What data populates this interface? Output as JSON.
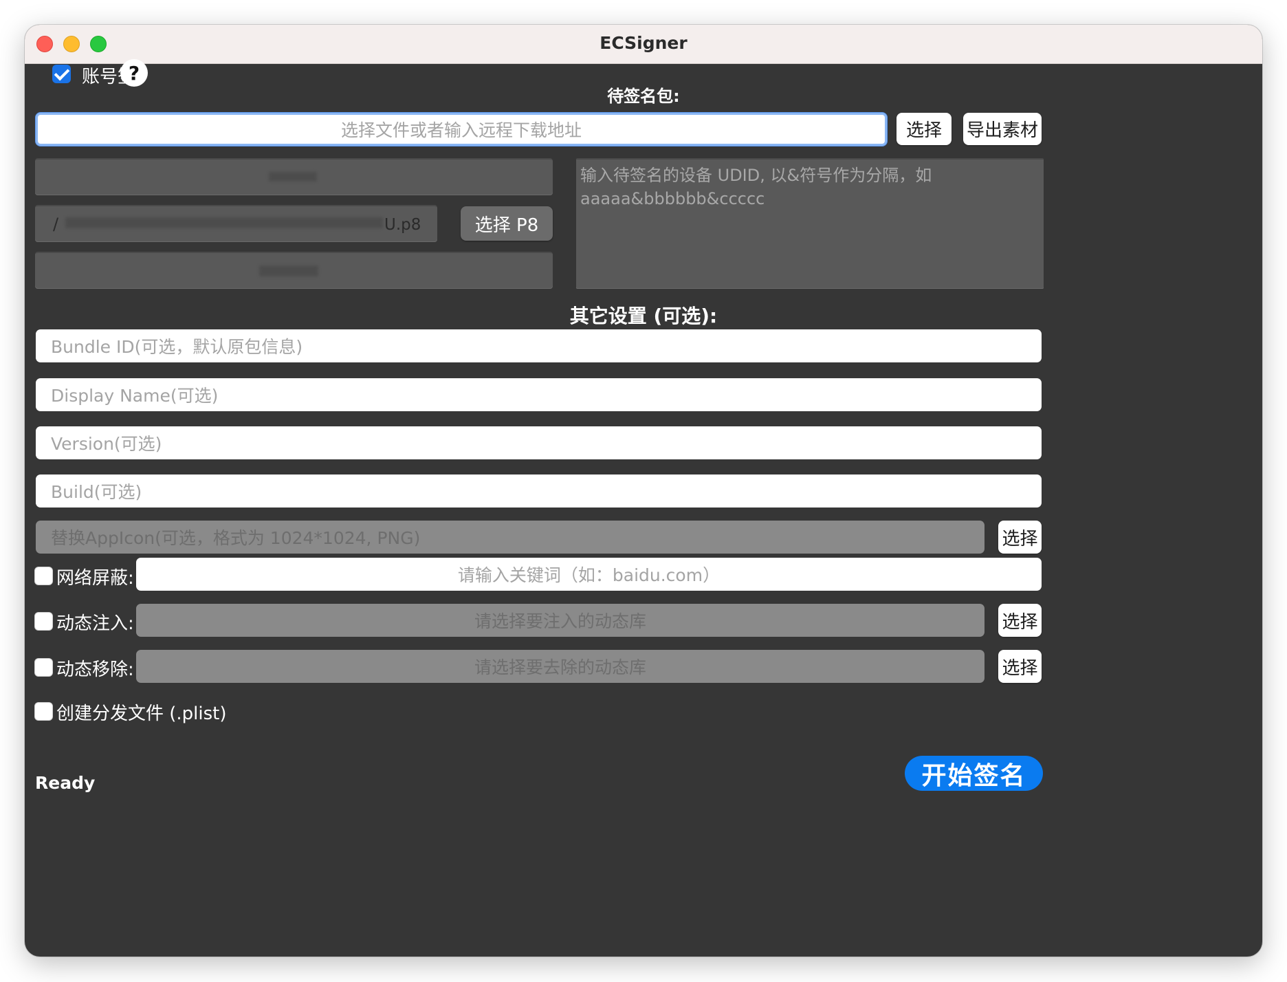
{
  "window": {
    "title": "ECSigner"
  },
  "account": {
    "checkbox_label": "账号签",
    "checked": true,
    "help_glyph": "?"
  },
  "package": {
    "heading": "待签名包:",
    "input_placeholder": "选择文件或者输入远程下载地址",
    "select_button": "选择",
    "export_button": "导出素材"
  },
  "credentials": {
    "p8_path_suffix": "U.p8",
    "p8_path_prefix": "/",
    "select_p8_button": "选择 P8"
  },
  "udid": {
    "placeholder": "输入待签名的设备 UDID, 以&符号作为分隔，如 aaaaa&bbbbbb&ccccc"
  },
  "other_settings": {
    "heading": "其它设置 (可选):",
    "bundle_id_placeholder": "Bundle ID(可选，默认原包信息)",
    "display_name_placeholder": "Display Name(可选)",
    "version_placeholder": "Version(可选)",
    "build_placeholder": "Build(可选)",
    "appicon_placeholder": "替换AppIcon(可选，格式为 1024*1024, PNG)",
    "appicon_select_button": "选择"
  },
  "network_block": {
    "label": "网络屏蔽:",
    "checked": false,
    "placeholder": "请输入关键词（如：baidu.com）"
  },
  "dylib_inject": {
    "label": "动态注入:",
    "checked": false,
    "placeholder": "请选择要注入的动态库",
    "select_button": "选择"
  },
  "dylib_remove": {
    "label": "动态移除:",
    "checked": false,
    "placeholder": "请选择要去除的动态库",
    "select_button": "选择"
  },
  "plist": {
    "label": "创建分发文件 (.plist)",
    "checked": false
  },
  "status": {
    "text": "Ready"
  },
  "start_button": {
    "label": "开始签名"
  },
  "colors": {
    "accent": "#0a7bf0",
    "background": "#363636",
    "titlebar": "#f4eeed"
  }
}
